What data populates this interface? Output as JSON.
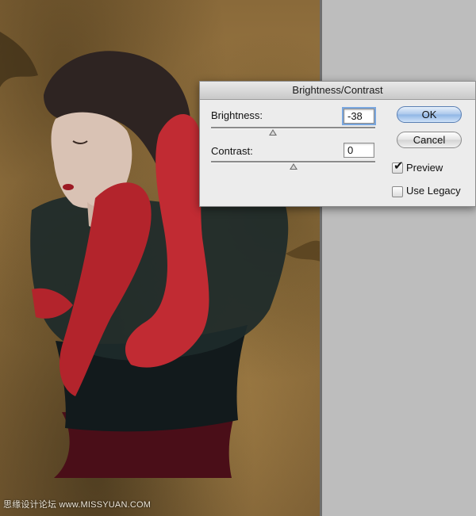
{
  "dialog": {
    "title": "Brightness/Contrast",
    "brightness": {
      "label": "Brightness:",
      "value": "-38"
    },
    "contrast": {
      "label": "Contrast:",
      "value": "0"
    },
    "buttons": {
      "ok": "OK",
      "cancel": "Cancel"
    },
    "options": {
      "preview": {
        "label": "Preview",
        "checked": true
      },
      "use_legacy": {
        "label": "Use Legacy",
        "checked": false
      }
    }
  },
  "watermark": "思缘设计论坛 www.MISSYUAN.COM",
  "colors": {
    "canvas_background": "#8a6a3a",
    "workspace": "#bdbdbd",
    "default_button": "#8fb5e5",
    "sleeve_red": "#b3242c"
  }
}
